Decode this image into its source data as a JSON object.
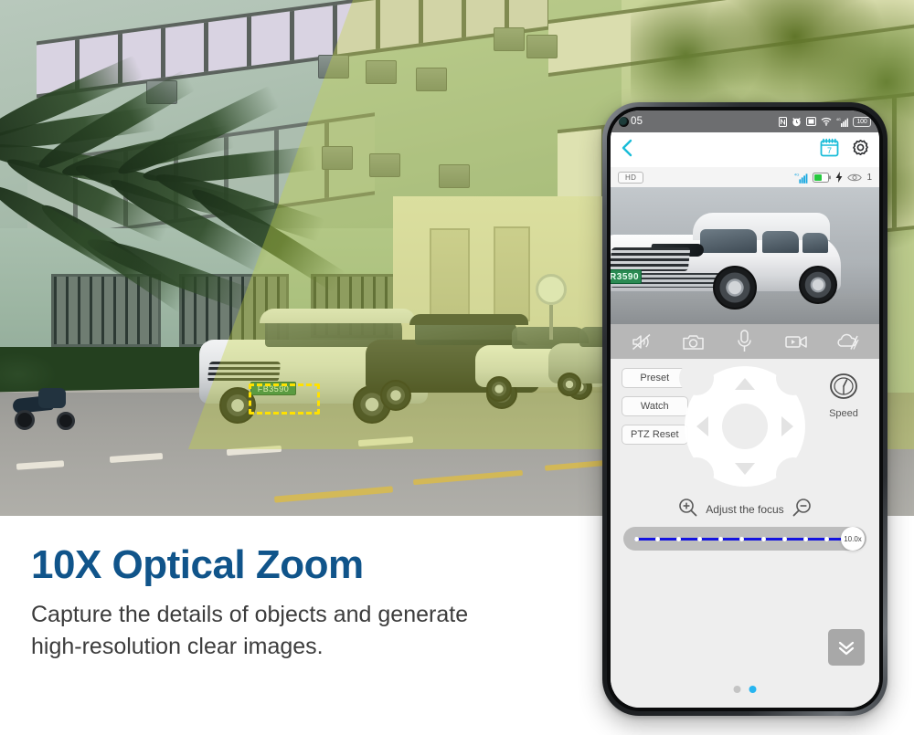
{
  "promo": {
    "headline": "10X Optical Zoom",
    "body_line1": "Capture the details of objects and generate",
    "body_line2": "high-resolution clear images."
  },
  "scene": {
    "highlight_plate": "FB3590",
    "beam_color": "#c4d63c",
    "highlight_box_color": "#ffe100"
  },
  "phone": {
    "statusbar": {
      "time": "05",
      "icons": [
        "nfc-icon",
        "alarm-icon",
        "screenshot-icon",
        "wifi-icon",
        "signal-icon"
      ],
      "battery_level": "100"
    },
    "navbar": {
      "back": "back-chevron-icon",
      "calendar_day": "7",
      "calendar": "calendar-icon",
      "settings": "gear-icon"
    },
    "inforow": {
      "quality_badge": "HD",
      "network": "4G",
      "signal": "signal-bars-icon",
      "battery": "battery-icon",
      "charging": "lightning-bolt-icon",
      "viewer_icon": "eye-icon",
      "viewer_count": "1"
    },
    "video": {
      "plate": "R3590"
    },
    "controlbar": [
      {
        "name": "mute-button",
        "icon": "speaker-mute-icon"
      },
      {
        "name": "snapshot-button",
        "icon": "camera-icon"
      },
      {
        "name": "talk-button",
        "icon": "microphone-icon"
      },
      {
        "name": "record-button",
        "icon": "video-camera-icon"
      },
      {
        "name": "playback-button",
        "icon": "cloud-slash-icon"
      }
    ],
    "ptz": {
      "buttons": [
        {
          "name": "preset-button",
          "label": "Preset"
        },
        {
          "name": "watch-button",
          "label": "Watch"
        },
        {
          "name": "ptz-reset-button",
          "label": "PTZ Reset"
        }
      ],
      "speed_label": "Speed",
      "speed_icon": "gauge-icon",
      "dpad": {
        "up": "arrow-up-icon",
        "down": "arrow-down-icon",
        "left": "arrow-left-icon",
        "right": "arrow-right-icon"
      }
    },
    "focus": {
      "label": "Adjust the focus",
      "zoom_in_icon": "magnifier-plus-icon",
      "zoom_out_icon": "magnifier-minus-icon"
    },
    "zoom_slider": {
      "value_label": "10.0x",
      "tick_count": 11,
      "track_color": "#1414e0"
    },
    "collapse": {
      "icon": "double-chevron-down-icon"
    },
    "pager": {
      "total": 2,
      "active_index": 1
    }
  }
}
